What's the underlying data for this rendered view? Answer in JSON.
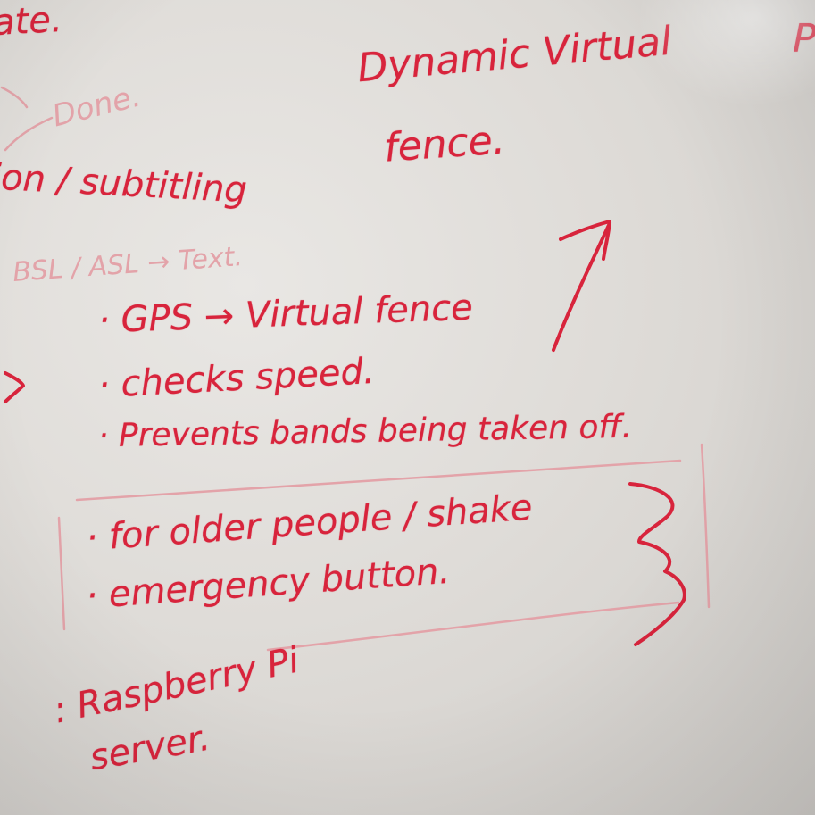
{
  "whiteboard": {
    "ink_color": "#d8243c",
    "faded_ink_color": "#e3a3a9",
    "background_color": "#e3e0dc",
    "notes": {
      "top_left_fragment": "ate.",
      "done": "Done.",
      "subtitling": "ion / subtitling",
      "bsl": "BSL / ASL → Text.",
      "dynamic_line1": "Dynamic Virtual",
      "dynamic_line2": "fence.",
      "top_right_fragment": "P",
      "gps": "· GPS → Virtual fence",
      "checks": "· checks speed.",
      "prevents": "· Prevents bands being taken off.",
      "older": "· for older people / shake",
      "emergency": "· emergency button.",
      "raspberry_line1": ": Raspberry Pi",
      "raspberry_line2": "server."
    }
  }
}
